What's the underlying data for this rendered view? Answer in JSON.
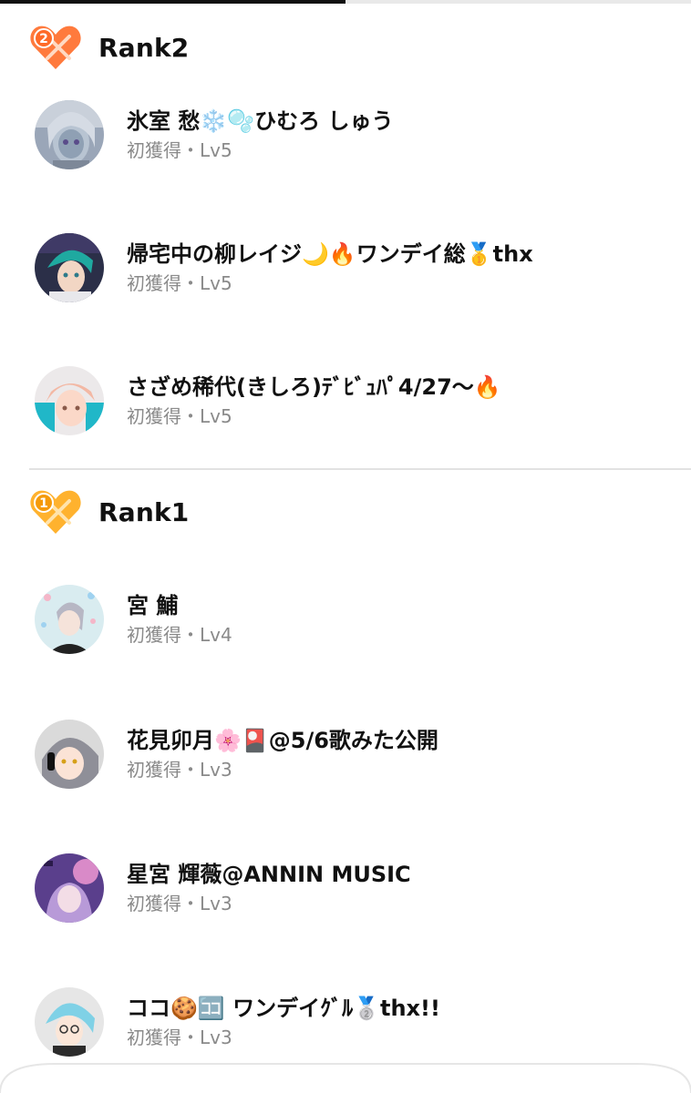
{
  "progress": {
    "fraction": 0.5
  },
  "sections": [
    {
      "title": "Rank2",
      "badge_number": "2",
      "badge_color": "#ff7a3d",
      "users": [
        {
          "name": "氷室 愁❄️🫧ひむろ しゅう",
          "meta": "初獲得・Lv5"
        },
        {
          "name": "帰宅中の柳レイジ🌙🔥ワンデイ総🥇thx",
          "meta": "初獲得・Lv5"
        },
        {
          "name": "さざめ稀代(きしろ)ﾃﾞﾋﾞｭﾊﾟ4/27〜🔥",
          "meta": "初獲得・Lv5"
        }
      ]
    },
    {
      "title": "Rank1",
      "badge_number": "1",
      "badge_color": "#ffb22e",
      "users": [
        {
          "name": "宮 鯆",
          "meta": "初獲得・Lv4"
        },
        {
          "name": "花見卯月🌸🎴@5/6歌みた公開",
          "meta": "初獲得・Lv3"
        },
        {
          "name": "星宮 輝薇@ANNIN MUSIC",
          "meta": "初獲得・Lv3"
        },
        {
          "name": "ココ🍪🈁 ワンデイｸﾞﾙ🥈thx!!",
          "meta": "初獲得・Lv3"
        }
      ]
    }
  ]
}
